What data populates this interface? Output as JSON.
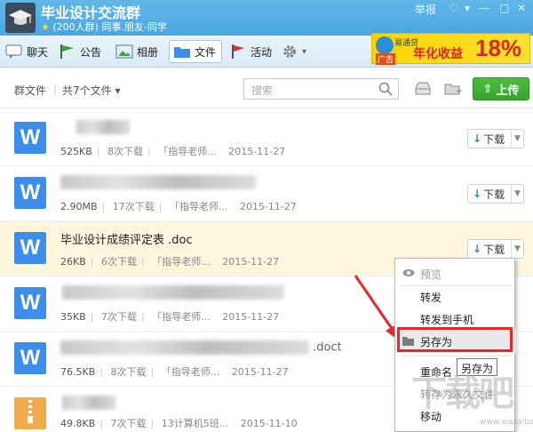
{
  "window": {
    "title": "毕业设计交流群",
    "subtitle_members": "(200人群)",
    "subtitle_tags": "同事.朋友-同学",
    "report": "举报",
    "controls": {
      "skin": "♡",
      "menu": "▾",
      "min": "—",
      "max": "□",
      "close": "✕"
    }
  },
  "toolbar": {
    "items": [
      {
        "label": "聊天",
        "icon": "chat-icon"
      },
      {
        "label": "公告",
        "icon": "announcement-flag-icon"
      },
      {
        "label": "相册",
        "icon": "photo-album-icon"
      },
      {
        "label": "文件",
        "icon": "folder-icon",
        "active": true
      },
      {
        "label": "活动",
        "icon": "activity-flag-icon"
      }
    ],
    "settings_caret": "▾"
  },
  "ad": {
    "brand": "易通贷",
    "tag": "广告",
    "text": "年化收益",
    "percent": "18%"
  },
  "filebar": {
    "group_files": "群文件",
    "separator": "|",
    "total_files": "共7个文件 ▾",
    "search_placeholder": "搜索",
    "upload_label": "上传",
    "upload_arrow": "⇧"
  },
  "files": [
    {
      "type": "word",
      "icon_letter": "W",
      "name": "",
      "size": "525KB",
      "downloads": "8次下载",
      "uploader": "「指导老师...",
      "date": "2015-11-27",
      "action": "下载"
    },
    {
      "type": "word",
      "icon_letter": "W",
      "name": "",
      "size": "2.90MB",
      "downloads": "17次下载",
      "uploader": "「指导老师...",
      "date": "2015-11-27",
      "action": "下载"
    },
    {
      "type": "word",
      "icon_letter": "W",
      "name": "毕业设计成绩评定表 .doc",
      "size": "26KB",
      "downloads": "6次下载",
      "uploader": "「指导老师...",
      "date": "2015-11-27",
      "action": "下载"
    },
    {
      "type": "word",
      "icon_letter": "W",
      "name": "",
      "size": "35KB",
      "downloads": "7次下载",
      "uploader": "「指导老师...",
      "date": "2015-11-27",
      "action": "下载"
    },
    {
      "type": "word",
      "icon_letter": "W",
      "name": "",
      "name_tail": ".doct",
      "size": "76.5KB",
      "downloads": "8次下载",
      "uploader": "「指导老师...",
      "date": "2015-11-27",
      "action": "下载"
    },
    {
      "type": "zip",
      "icon_letter": "",
      "name": "",
      "size": "49.8KB",
      "downloads": "7次下载",
      "uploader": "13计算机5班...",
      "date": "2015-11-10",
      "action": "下载"
    }
  ],
  "context_menu": {
    "items": [
      {
        "label": "预览",
        "disabled": true,
        "icon": "eye-icon"
      },
      {
        "label": "转发"
      },
      {
        "label": "转发到手机"
      },
      {
        "label": "另存为",
        "selected": true,
        "icon": "folder-icon"
      },
      {
        "label": "重命名"
      },
      {
        "label": "转存为永久文件"
      },
      {
        "label": "移动"
      }
    ],
    "tooltip": "另存为"
  },
  "watermark": {
    "text": "下载吧",
    "url": "www.xiazaiba.com"
  },
  "colors": {
    "title_bar": "#4aa6e0",
    "upload_green": "#3cab2e",
    "word_blue": "#3d8eea",
    "highlight_row": "#fef6dc",
    "annotation_red": "#e62a2a"
  }
}
